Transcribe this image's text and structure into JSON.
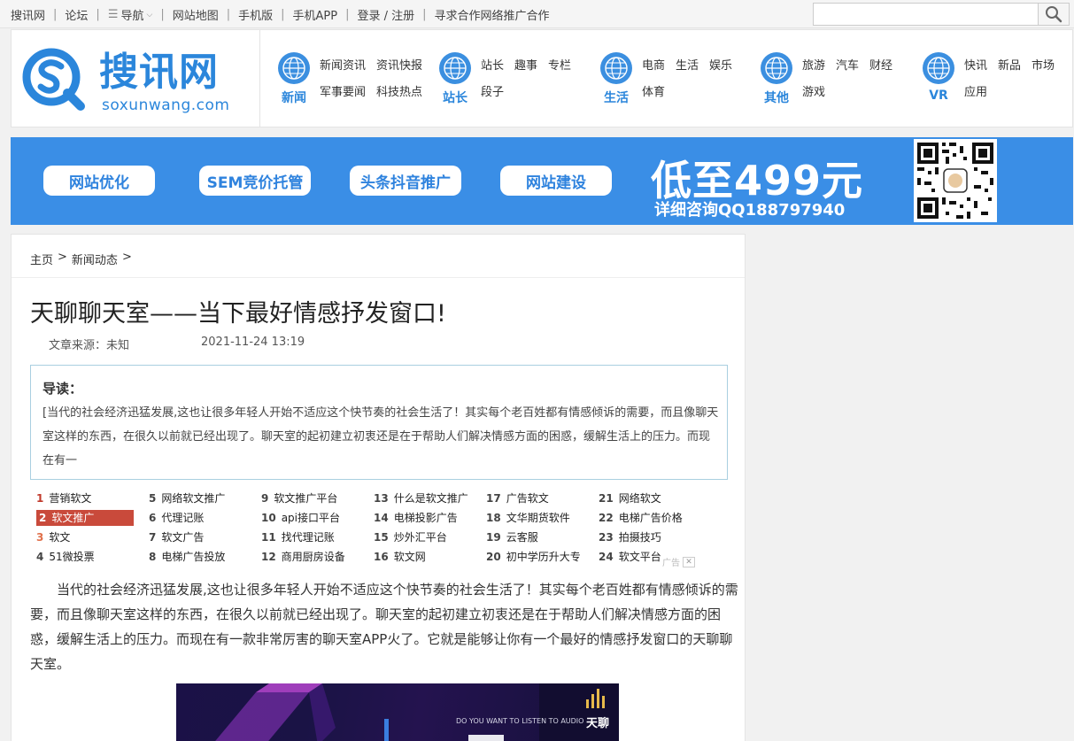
{
  "topbar": {
    "links": [
      "搜讯网",
      "论坛",
      "导航",
      "网站地图",
      "手机版",
      "手机APP",
      "登录 / 注册",
      "寻求合作网络推广合作"
    ],
    "search_placeholder": ""
  },
  "logo": {
    "name": "搜讯网",
    "domain": "soxunwang.com",
    "brand_color": "#2b86db"
  },
  "nav_groups": [
    {
      "name": "新闻",
      "links": [
        "新闻资讯",
        "资讯快报",
        "军事要闻",
        "科技热点"
      ]
    },
    {
      "name": "站长",
      "links": [
        "站长",
        "趣事",
        "专栏",
        "段子"
      ]
    },
    {
      "name": "生活",
      "links": [
        "电商",
        "生活",
        "娱乐",
        "体育"
      ]
    },
    {
      "name": "其他",
      "links": [
        "旅游",
        "汽车",
        "财经",
        "游戏"
      ]
    },
    {
      "name": "VR",
      "links": [
        "快讯",
        "新品",
        "市场",
        "应用"
      ]
    }
  ],
  "banner": {
    "buttons": [
      "网站优化",
      "SEM竞价托管",
      "头条抖音推广",
      "网站建设"
    ],
    "price": "低至499元",
    "consult": "详细咨询QQ188797940",
    "bg_color": "#3a8ee6"
  },
  "breadcrumb": [
    "主页",
    ">",
    "新闻动态",
    ">"
  ],
  "article": {
    "title": "天聊聊天室——当下最好情感抒发窗口!",
    "source": "文章来源：未知",
    "date": "2021-11-24 13:19",
    "lead_label": "导读：",
    "lead_text": "[当代的社会经济迅猛发展,这也让很多年轻人开始不适应这个快节奏的社会生活了！其实每个老百姓都有情感倾诉的需要，而且像聊天室这样的东西，在很久以前就已经出现了。聊天室的起初建立初衷还是在于帮助人们解决情感方面的困惑，缓解生活上的压力。而现在有一",
    "body": "当代的社会经济迅猛发展,这也让很多年轻人开始不适应这个快节奏的社会生活了！其实每个老百姓都有情感倾诉的需要，而且像聊天室这样的东西，在很久以前就已经出现了。聊天室的起初建立初衷还是在于帮助人们解决情感方面的困惑，缓解生活上的压力。而现在有一款非常厉害的聊天室APP火了。它就是能够让你有一个最好的情感抒发窗口的天聊聊天室。"
  },
  "keywords": [
    {
      "n": "1",
      "t": "营销软文"
    },
    {
      "n": "2",
      "t": "软文推广"
    },
    {
      "n": "3",
      "t": "软文"
    },
    {
      "n": "4",
      "t": "51微投票"
    },
    {
      "n": "5",
      "t": "网络软文推广"
    },
    {
      "n": "6",
      "t": "代理记账"
    },
    {
      "n": "7",
      "t": "软文广告"
    },
    {
      "n": "8",
      "t": "电梯广告投放"
    },
    {
      "n": "9",
      "t": "软文推广平台"
    },
    {
      "n": "10",
      "t": "api接口平台"
    },
    {
      "n": "11",
      "t": "找代理记账"
    },
    {
      "n": "12",
      "t": "商用厨房设备"
    },
    {
      "n": "13",
      "t": "什么是软文推广"
    },
    {
      "n": "14",
      "t": "电梯投影广告"
    },
    {
      "n": "15",
      "t": "炒外汇平台"
    },
    {
      "n": "16",
      "t": "软文网"
    },
    {
      "n": "17",
      "t": "广告软文"
    },
    {
      "n": "18",
      "t": "文华期货软件"
    },
    {
      "n": "19",
      "t": "云客服"
    },
    {
      "n": "20",
      "t": "初中学历升大专"
    },
    {
      "n": "21",
      "t": "网络软文"
    },
    {
      "n": "22",
      "t": "电梯广告价格"
    },
    {
      "n": "23",
      "t": "拍摄技巧"
    },
    {
      "n": "24",
      "t": "软文平台"
    }
  ],
  "ad_label": "广告",
  "hero_text": {
    "line1": "DO YOU WANT TO LISTEN TO AUDIO",
    "brand": "天聊"
  }
}
